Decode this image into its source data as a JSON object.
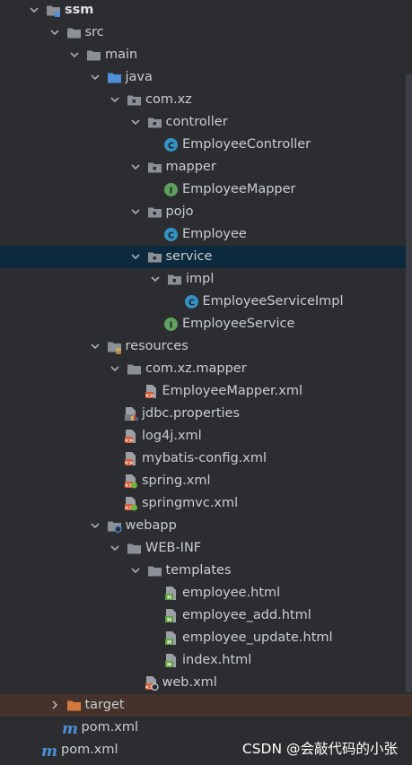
{
  "colors": {
    "background": "#2b2d30",
    "selected_row": "#0d293e",
    "excluded_row": "#45322b",
    "folder": "#8a9096",
    "source_folder": "#4f8fd8",
    "excluded_folder": "#d4793d",
    "class_icon": "#3592c4",
    "interface_icon": "#5fa15d",
    "xml_icon": "#d45b3a",
    "html_icon": "#5e9f3a"
  },
  "project_tree": [
    {
      "label": "ssm",
      "icon": "module-folder-icon",
      "level": 0,
      "expanded": true,
      "bold": true
    },
    {
      "label": "src",
      "icon": "folder-icon",
      "level": 1,
      "expanded": true
    },
    {
      "label": "main",
      "icon": "folder-icon",
      "level": 2,
      "expanded": true
    },
    {
      "label": "java",
      "icon": "source-folder-icon",
      "level": 3,
      "expanded": true
    },
    {
      "label": "com.xz",
      "icon": "package-icon",
      "level": 4,
      "expanded": true
    },
    {
      "label": "controller",
      "icon": "package-icon",
      "level": 5,
      "expanded": true
    },
    {
      "label": "EmployeeController",
      "icon": "java-class-icon",
      "level": 6
    },
    {
      "label": "mapper",
      "icon": "package-icon",
      "level": 5,
      "expanded": true
    },
    {
      "label": "EmployeeMapper",
      "icon": "java-interface-icon",
      "level": 6
    },
    {
      "label": "pojo",
      "icon": "package-icon",
      "level": 5,
      "expanded": true
    },
    {
      "label": "Employee",
      "icon": "java-class-icon",
      "level": 6
    },
    {
      "label": "service",
      "icon": "package-icon",
      "level": 5,
      "expanded": true,
      "selected": true
    },
    {
      "label": "impl",
      "icon": "package-icon",
      "level": 6,
      "expanded": true
    },
    {
      "label": "EmployeeServiceImpl",
      "icon": "java-class-icon",
      "level": 7
    },
    {
      "label": "EmployeeService",
      "icon": "java-interface-icon",
      "level": 6
    },
    {
      "label": "resources",
      "icon": "resources-folder-icon",
      "level": 3,
      "expanded": true
    },
    {
      "label": "com.xz.mapper",
      "icon": "folder-icon",
      "level": 4,
      "expanded": true
    },
    {
      "label": "EmployeeMapper.xml",
      "icon": "xml-file-icon",
      "level": 5
    },
    {
      "label": "jdbc.properties",
      "icon": "properties-file-icon",
      "level": 4
    },
    {
      "label": "log4j.xml",
      "icon": "xml-file-icon",
      "level": 4
    },
    {
      "label": "mybatis-config.xml",
      "icon": "xml-file-icon",
      "level": 4
    },
    {
      "label": "spring.xml",
      "icon": "spring-xml-file-icon",
      "level": 4
    },
    {
      "label": "springmvc.xml",
      "icon": "spring-xml-file-icon",
      "level": 4
    },
    {
      "label": "webapp",
      "icon": "web-folder-icon",
      "level": 3,
      "expanded": true
    },
    {
      "label": "WEB-INF",
      "icon": "folder-icon",
      "level": 4,
      "expanded": true
    },
    {
      "label": "templates",
      "icon": "folder-icon",
      "level": 5,
      "expanded": true
    },
    {
      "label": "employee.html",
      "icon": "html-file-icon",
      "level": 6
    },
    {
      "label": "employee_add.html",
      "icon": "html-file-icon",
      "level": 6
    },
    {
      "label": "employee_update.html",
      "icon": "html-file-icon",
      "level": 6
    },
    {
      "label": "index.html",
      "icon": "html-file-icon",
      "level": 6
    },
    {
      "label": "web.xml",
      "icon": "web-xml-file-icon",
      "level": 5
    },
    {
      "label": "target",
      "icon": "excluded-folder-icon",
      "level": 1,
      "expanded": false,
      "highlighted": true
    },
    {
      "label": "pom.xml",
      "icon": "maven-file-icon",
      "level": 1
    },
    {
      "label": "pom.xml",
      "icon": "maven-file-icon",
      "level": 0
    }
  ],
  "watermark": "CSDN @会敲代码的小张"
}
